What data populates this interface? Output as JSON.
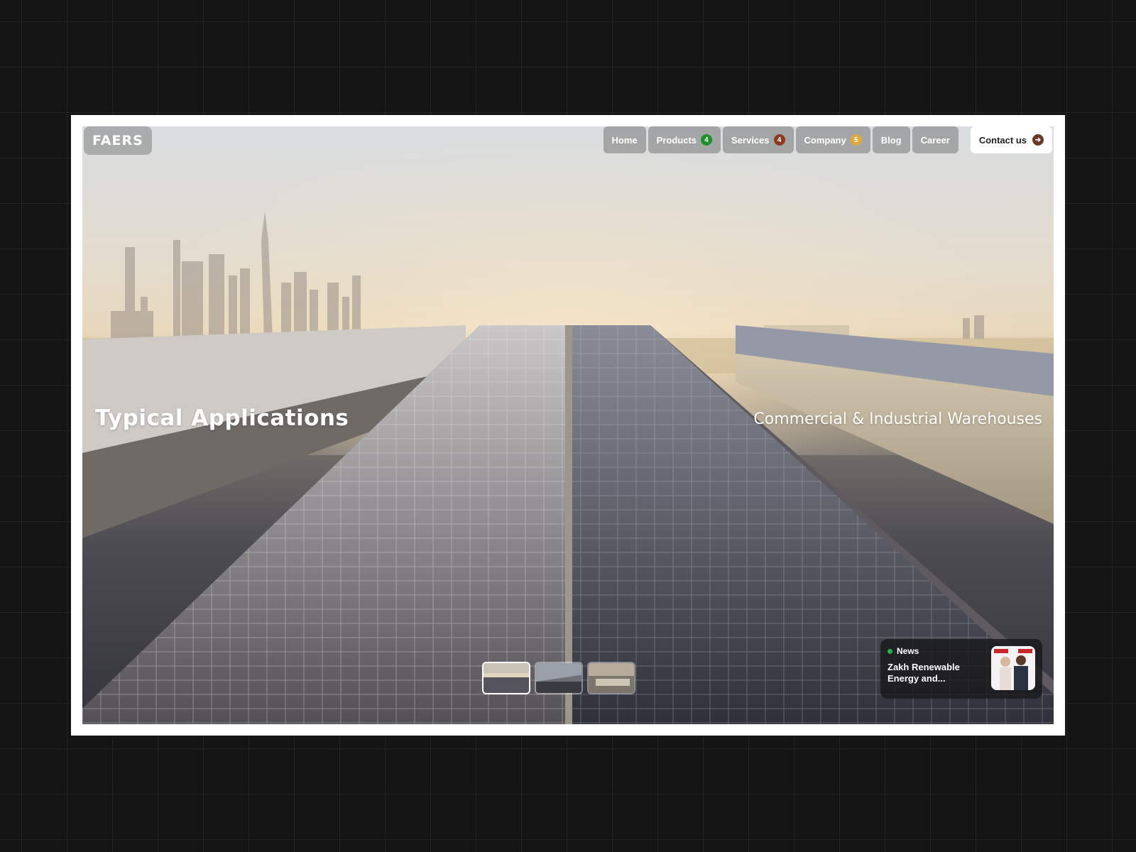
{
  "brand": {
    "logo_text": "FAERS"
  },
  "nav": {
    "items": [
      {
        "label": "Home"
      },
      {
        "label": "Products",
        "badge": "4",
        "badge_color": "#1f8f2e"
      },
      {
        "label": "Services",
        "badge": "4",
        "badge_color": "#8a3b22"
      },
      {
        "label": "Company",
        "badge": "5",
        "badge_color": "#e0a83a"
      },
      {
        "label": "Blog"
      },
      {
        "label": "Career"
      }
    ],
    "contact_label": "Contact us",
    "contact_icon": "arrow-right-icon"
  },
  "hero": {
    "headline": "Typical Applications",
    "subhead": "Commercial & Industrial Warehouses"
  },
  "news": {
    "tag": "News",
    "title": "Zakh Renewable Energy and..."
  },
  "colors": {
    "page_background": "#141414",
    "nav_pill": "#808080",
    "contact_arrow": "#6b3a26",
    "news_dot": "#22b14c"
  }
}
